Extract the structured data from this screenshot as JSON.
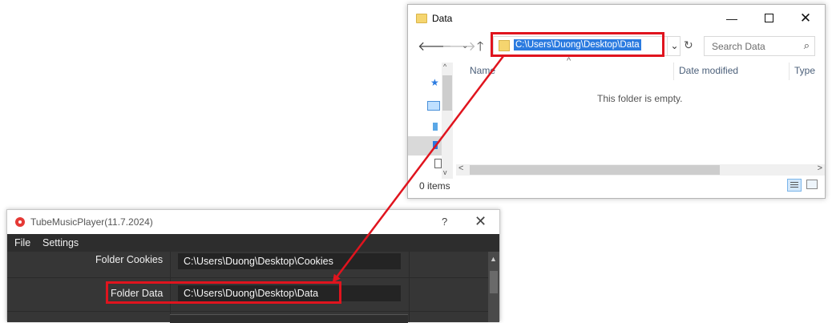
{
  "explorer": {
    "title": "Data",
    "controls": {
      "minimize": "—",
      "close": "✕"
    },
    "nav": {
      "back": "🡐",
      "forward": "🡒",
      "recent": "⌄",
      "up": "🡑"
    },
    "address": {
      "path": "C:\\Users\\Duong\\Desktop\\Data",
      "dropdown": "⌄",
      "refresh": "↻"
    },
    "search": {
      "placeholder": "Search Data",
      "icon": "⌕"
    },
    "columns": {
      "sort_indicator": "^",
      "name": "Name",
      "date_modified": "Date modified",
      "type": "Type"
    },
    "empty_message": "This folder is empty.",
    "scroll": {
      "left": "<",
      "right": ">",
      "up": "^",
      "down": "v"
    },
    "status": {
      "items": "0 items"
    },
    "nav_icons": [
      "pin-icon",
      "this-pc-icon",
      "network-icon",
      "folder-icon",
      "document-icon"
    ]
  },
  "app": {
    "title": "TubeMusicPlayer(11.7.2024)",
    "help": "?",
    "close": "✕",
    "menu": {
      "file": "File",
      "settings": "Settings"
    },
    "settings": {
      "cookies_label": "Folder Cookies",
      "cookies_value": "C:\\Users\\Duong\\Desktop\\Cookies",
      "data_label": "Folder Data",
      "data_value": "C:\\Users\\Duong\\Desktop\\Data"
    },
    "scroll_up": "▲"
  },
  "annotation": {
    "color": "#e0141e"
  }
}
